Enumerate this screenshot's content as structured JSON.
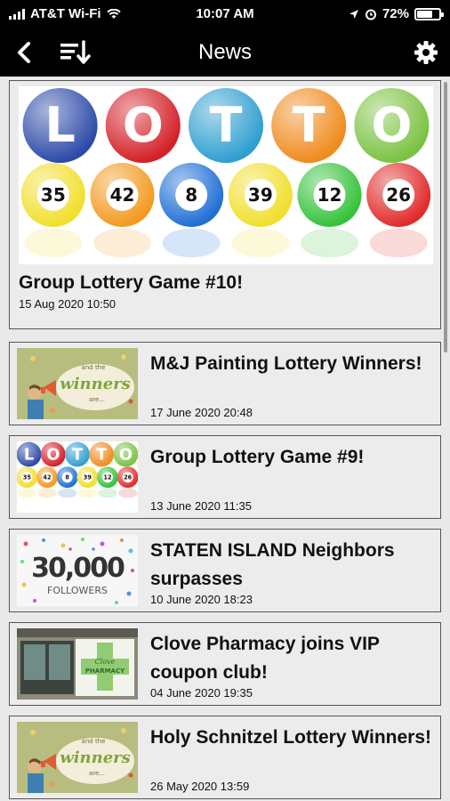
{
  "status": {
    "carrier": "AT&T Wi-Fi",
    "time": "10:07 AM",
    "battery": "72%",
    "battery_level": 0.72
  },
  "nav": {
    "title": "News",
    "back_icon": "chevron-left-icon",
    "sort_icon": "sort-descending-icon",
    "settings_icon": "gear-icon"
  },
  "colors": {
    "bar": "#000000",
    "background": "#e9e9e9",
    "card": "#ececec",
    "border": "#555555"
  },
  "featured": {
    "title": "Group Lottery Game #10!",
    "date": "15 Aug 2020 10:50",
    "image": {
      "letters": [
        "L",
        "O",
        "T",
        "T",
        "O"
      ],
      "balls": [
        "35",
        "42",
        "8",
        "39",
        "12",
        "26"
      ]
    }
  },
  "news": [
    {
      "title": "M&J Painting Lottery Winners!",
      "date": "17 June 2020 20:48",
      "thumb": "winners"
    },
    {
      "title": "Group Lottery Game #9!",
      "date": "13 June 2020 11:35",
      "thumb": "lotto"
    },
    {
      "title": "STATEN ISLAND Neighbors surpasses",
      "date": "10 June 2020 18:23",
      "thumb": "followers"
    },
    {
      "title": "Clove Pharmacy joins VIP coupon club!",
      "date": "04 June 2020 19:35",
      "thumb": "pharmacy"
    },
    {
      "title": "Holy Schnitzel Lottery Winners!",
      "date": "26 May 2020 13:59",
      "thumb": "winners"
    }
  ],
  "thumbs": {
    "winners": {
      "line1": "and the",
      "line2": "winners",
      "line3": "are..."
    },
    "followers": {
      "number": "30,000",
      "label": "FOLLOWERS"
    },
    "pharmacy": {
      "line1": "Clove",
      "line2": "PHARMACY"
    }
  }
}
